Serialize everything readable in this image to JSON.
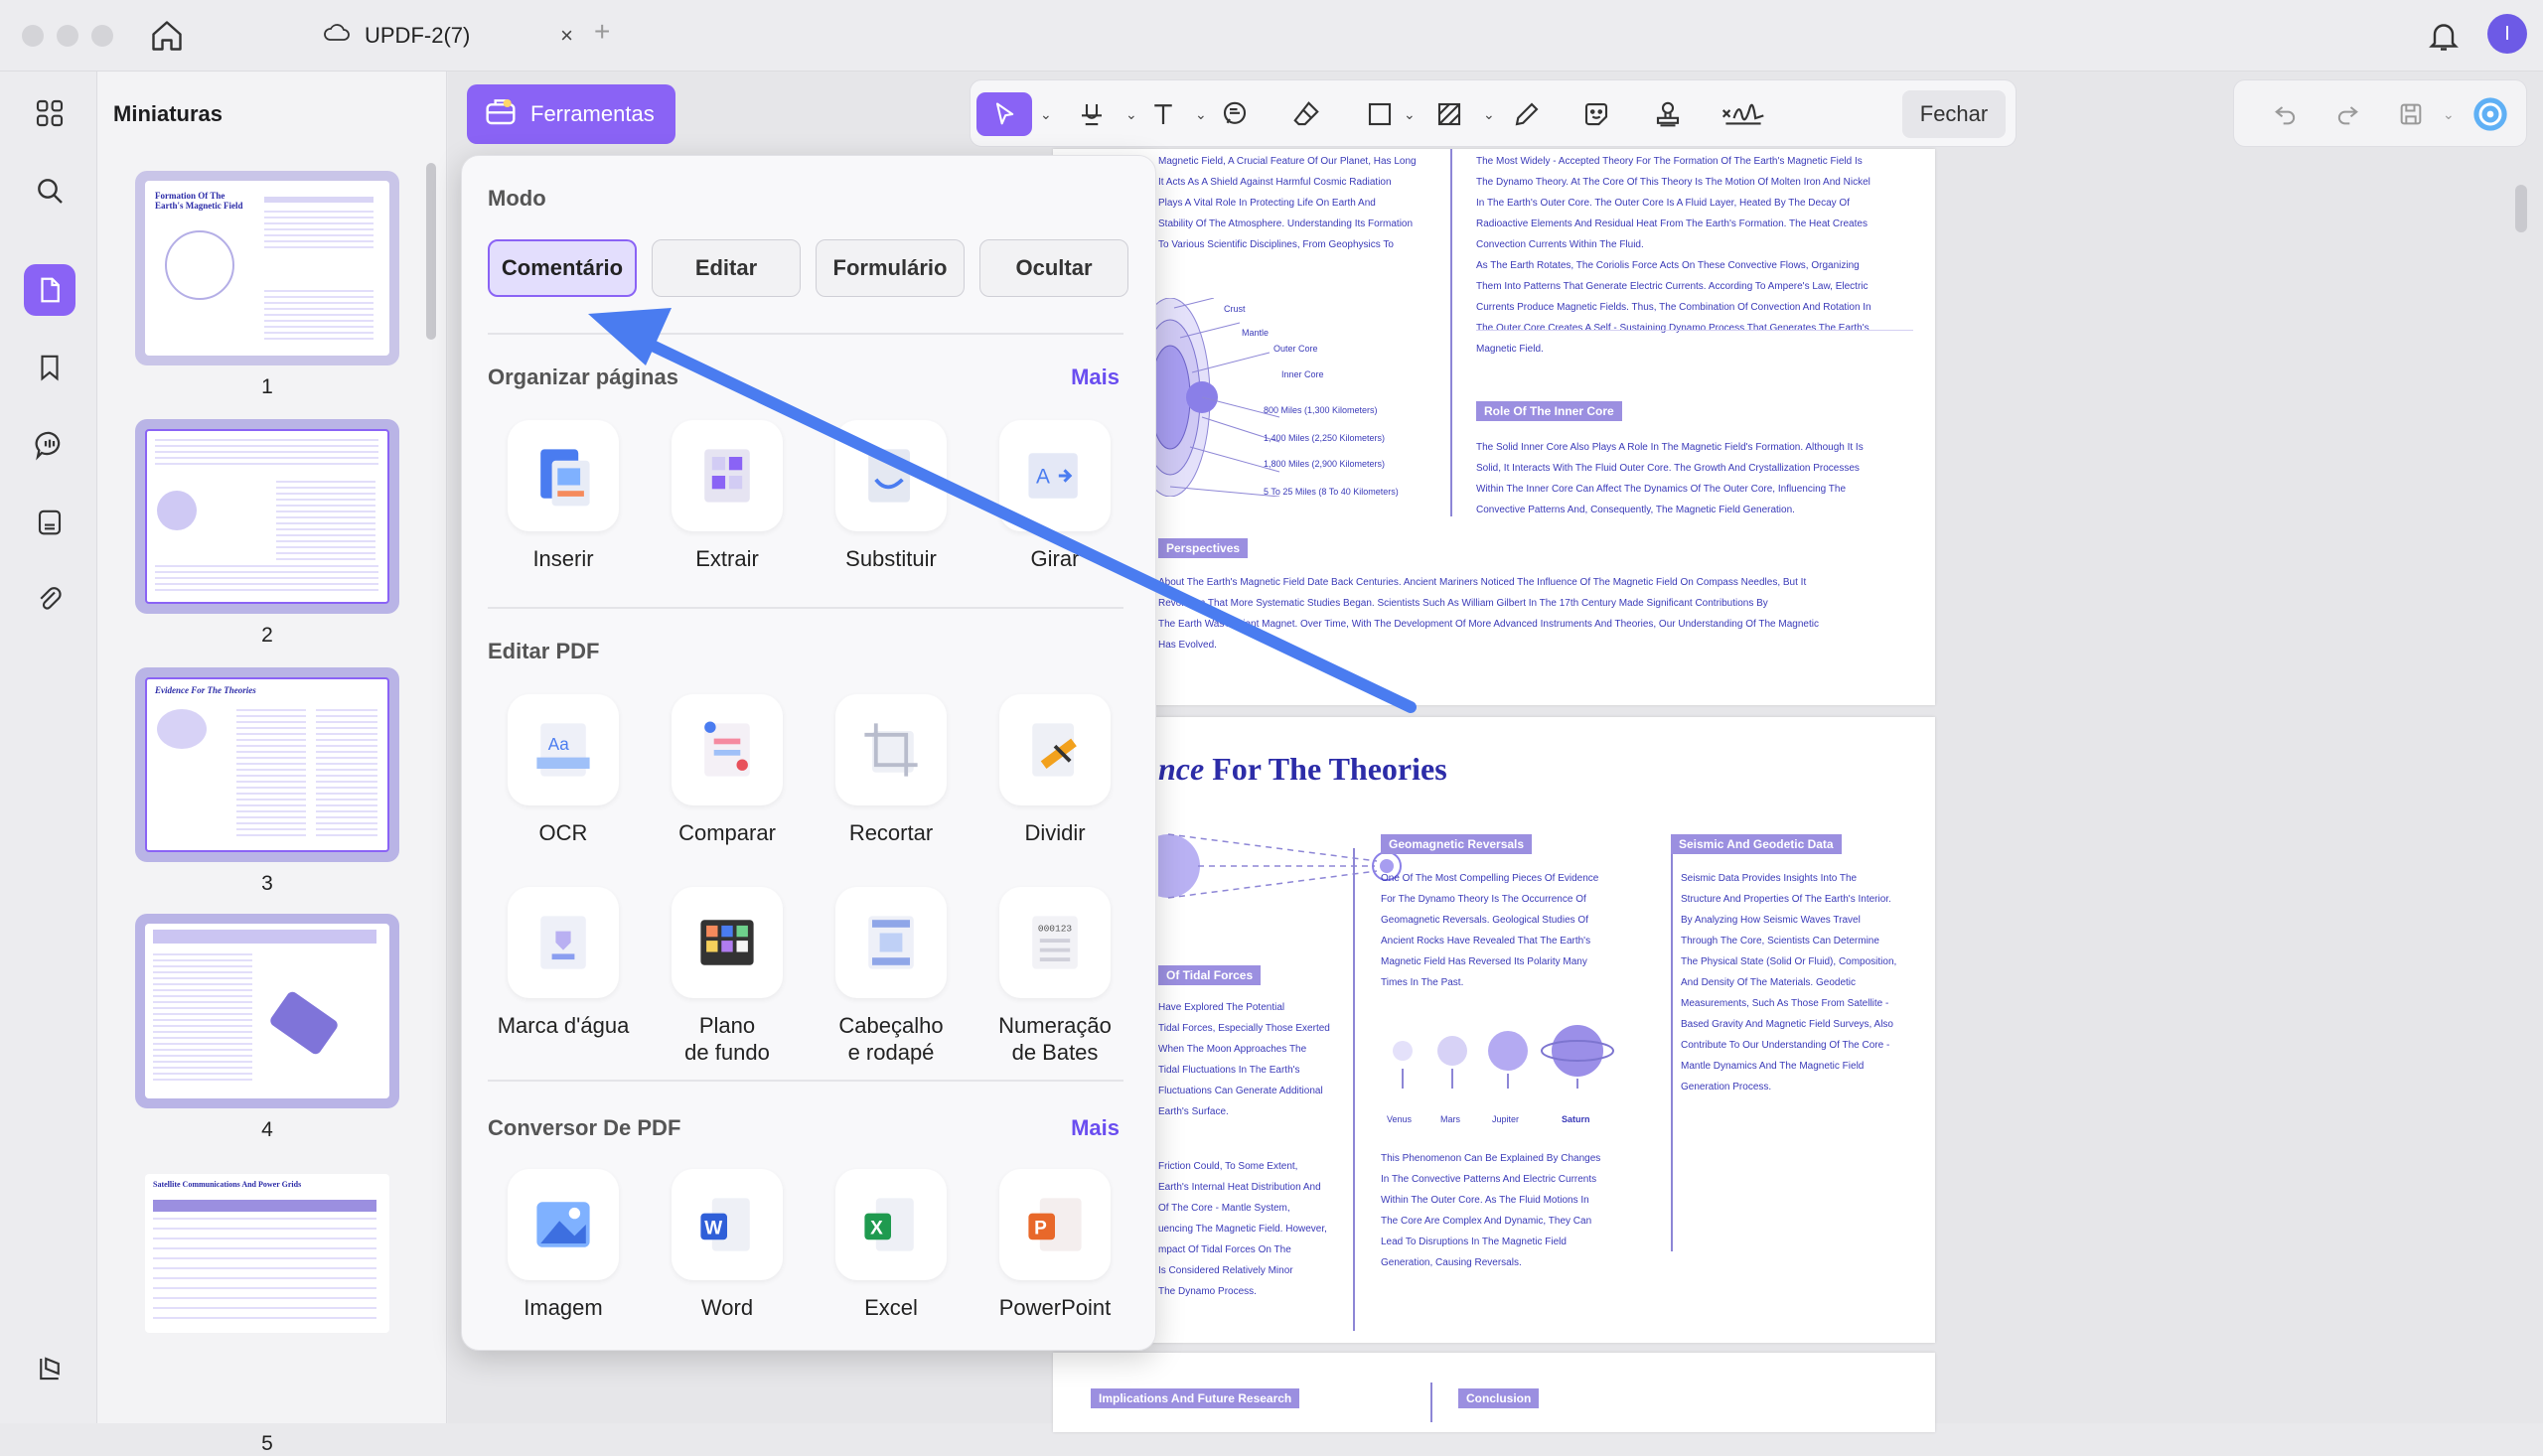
{
  "window": {
    "tab_title": "UPDF-2(7)",
    "close_glyph": "×",
    "new_tab_glyph": "+",
    "avatar_letter": "I"
  },
  "thumbnails": {
    "title": "Miniaturas",
    "pages": [
      "1",
      "2",
      "3",
      "4",
      "5"
    ],
    "page1_title": "Formation Of The Earth's Magnetic Field",
    "page3_title": "Evidence For The Theories",
    "page5_title": "Satellite Communications And Power Grids"
  },
  "toolbar": {
    "tools_label": "Ferramentas",
    "close_label": "Fechar"
  },
  "popup": {
    "mode_title": "Modo",
    "modes": [
      "Comentário",
      "Editar",
      "Formulário",
      "Ocultar"
    ],
    "organize_title": "Organizar páginas",
    "organize_more": "Mais",
    "organize_items": [
      "Inserir",
      "Extrair",
      "Substituir",
      "Girar"
    ],
    "edit_title": "Editar PDF",
    "edit_items": [
      "OCR",
      "Comparar",
      "Recortar",
      "Dividir",
      "Marca d'água",
      "Plano\nde fundo",
      "Cabeçalho\ne rodapé",
      "Numeração\nde Bates"
    ],
    "convert_title": "Conversor De PDF",
    "convert_more": "Mais",
    "convert_items": [
      "Imagem",
      "Word",
      "Excel",
      "PowerPoint"
    ]
  },
  "document": {
    "p1_col1": "Magnetic Field, A Crucial Feature Of Our Planet, Has Long\nIt Acts As A Shield Against Harmful Cosmic Radiation\nPlays A Vital Role In Protecting Life On Earth And\nStability Of The Atmosphere. Understanding Its Formation\nTo Various Scientific Disciplines, From Geophysics To",
    "p1_col2": "The Most Widely - Accepted Theory For The Formation Of The Earth's Magnetic Field Is\nThe Dynamo Theory. At The Core Of This Theory Is The Motion Of Molten Iron And Nickel\nIn The Earth's Outer Core. The Outer Core Is A Fluid Layer, Heated By The Decay Of\nRadioactive Elements And Residual Heat From The Earth's Formation. The Heat Creates\nConvection Currents Within The Fluid.\nAs The Earth Rotates, The Coriolis Force Acts On These Convective Flows, Organizing\nThem Into Patterns That Generate Electric Currents. According To Ampere's Law, Electric\nCurrents Produce Magnetic Fields. Thus, The Combination Of Convection And Rotation In\nThe Outer Core Creates A Self - Sustaining Dynamo Process That Generates The Earth's\nMagnetic Field.",
    "inner_core_heading": "Role Of The Inner Core",
    "inner_core_text": "The Solid Inner Core Also Plays A Role In The Magnetic Field's Formation. Although It Is\nSolid, It Interacts With The Fluid Outer Core. The Growth And Crystallization Processes\nWithin The Inner Core Can Affect The Dynamics Of The Outer Core, Influencing The\nConvective Patterns And, Consequently, The Magnetic Field Generation.",
    "diagram_labels": [
      "Crust",
      "Mantle",
      "Outer Core",
      "Inner Core",
      "800 Miles (1,300 Kilometers)",
      "1,400 Miles (2,250 Kilometers)",
      "1,800 Miles (2,900 Kilometers)",
      "5 To 25 Miles (8 To 40 Kilometers)"
    ],
    "perspectives_heading": "Perspectives",
    "perspectives_text": "About The Earth's Magnetic Field Date Back Centuries. Ancient Mariners Noticed The Influence Of The Magnetic Field On Compass Needles, But It\nRevolution That More Systematic Studies Began. Scientists Such As William Gilbert In The 17th Century Made Significant Contributions By\nThe Earth Was A Giant Magnet. Over Time, With The Development Of More Advanced Instruments And Theories, Our Understanding Of The Magnetic\nHas Evolved.",
    "p2_title_italic": "nce",
    "p2_title_rest": " For The Theories",
    "geomag_heading": "Geomagnetic Reversals",
    "geomag_text": "One Of The Most Compelling Pieces Of Evidence\nFor The Dynamo Theory Is The Occurrence Of\nGeomagnetic Reversals. Geological Studies Of\nAncient Rocks Have Revealed That The Earth's\nMagnetic Field Has Reversed Its Polarity Many\nTimes In The Past.",
    "seismic_heading": "Seismic And Geodetic Data",
    "seismic_text": "Seismic Data Provides Insights Into The\nStructure And Properties Of The Earth's Interior.\nBy Analyzing How Seismic Waves Travel\nThrough The Core, Scientists Can Determine\nThe Physical State (Solid Or Fluid), Composition,\nAnd Density Of The Materials. Geodetic\nMeasurements, Such As Those From Satellite -\nBased Gravity And Magnetic Field Surveys, Also\nContribute To Our Understanding Of The Core -\nMantle Dynamics And The Magnetic Field\nGeneration Process.",
    "tidal_heading": "Of Tidal Forces",
    "tidal_text": "Have Explored The Potential\nTidal Forces, Especially Those Exerted\nWhen The Moon Approaches The\nTidal Fluctuations In The Earth's\nFluctuations Can Generate Additional\nEarth's Surface.",
    "tidal_text2": "Friction Could, To Some Extent,\nEarth's Internal Heat Distribution And\nOf The Core - Mantle System,\nuencing The Magnetic Field. However,\nmpact Of Tidal Forces On The\nIs Considered Relatively Minor\nThe Dynamo Process.",
    "planet_labels": [
      "Venus",
      "Mars",
      "Jupiter",
      "Saturn"
    ],
    "phenomenon_text": "This Phenomenon Can Be Explained By Changes\nIn The Convective Patterns And Electric Currents\nWithin The Outer Core. As The Fluid Motions In\nThe Core Are Complex And Dynamic, They Can\nLead To Disruptions In The Magnetic Field\nGeneration, Causing Reversals.",
    "implications_heading": "Implications And Future Research",
    "conclusion_heading": "Conclusion"
  },
  "colors": {
    "accent": "#8a63f5",
    "arrow": "#4a7cf0",
    "doc_text": "#3a3ab8"
  }
}
